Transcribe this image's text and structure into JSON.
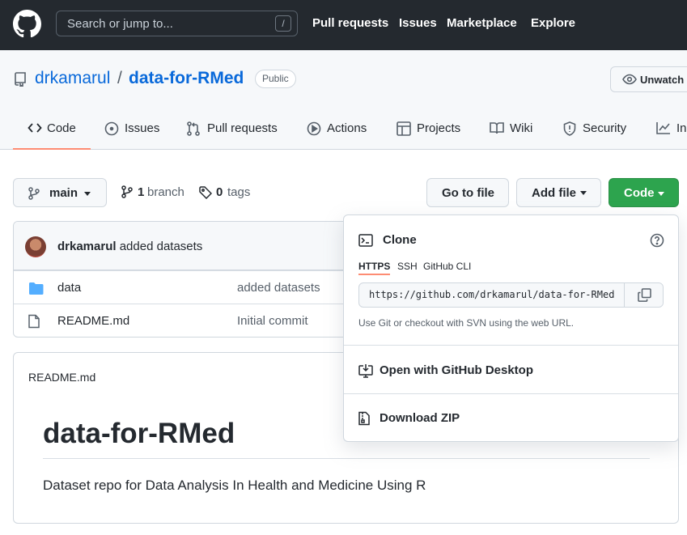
{
  "header": {
    "search_placeholder": "Search or jump to...",
    "search_shortcut": "/",
    "nav": [
      "Pull requests",
      "Issues",
      "Marketplace",
      "Explore"
    ]
  },
  "repo": {
    "owner": "drkamarul",
    "separator": "/",
    "name": "data-for-RMed",
    "visibility": "Public",
    "watch_label": "Unwatch",
    "tabs": [
      "Code",
      "Issues",
      "Pull requests",
      "Actions",
      "Projects",
      "Wiki",
      "Security",
      "In"
    ]
  },
  "toolbar": {
    "branch": "main",
    "branch_count": "1",
    "branch_label": "branch",
    "tag_count": "0",
    "tag_label": "tags",
    "go_to_file": "Go to file",
    "add_file": "Add file",
    "code": "Code"
  },
  "commit": {
    "author": "drkamarul",
    "message": "added datasets"
  },
  "files": [
    {
      "name": "data",
      "message": "added datasets",
      "type": "folder"
    },
    {
      "name": "README.md",
      "message": "Initial commit",
      "type": "file"
    }
  ],
  "readme": {
    "title": "README.md",
    "heading": "data-for-RMed",
    "description": "Dataset repo for Data Analysis In Health and Medicine Using R"
  },
  "clone": {
    "title": "Clone",
    "tabs": [
      "HTTPS",
      "SSH",
      "GitHub CLI"
    ],
    "url": "https://github.com/drkamarul/data-for-RMed",
    "hint": "Use Git or checkout with SVN using the web URL.",
    "open_desktop": "Open with GitHub Desktop",
    "download_zip": "Download ZIP"
  },
  "colors": {
    "header_bg": "#24292f",
    "link": "#0969da",
    "primary_button": "#2da44e",
    "active_tab_underline": "#fd8c73"
  }
}
